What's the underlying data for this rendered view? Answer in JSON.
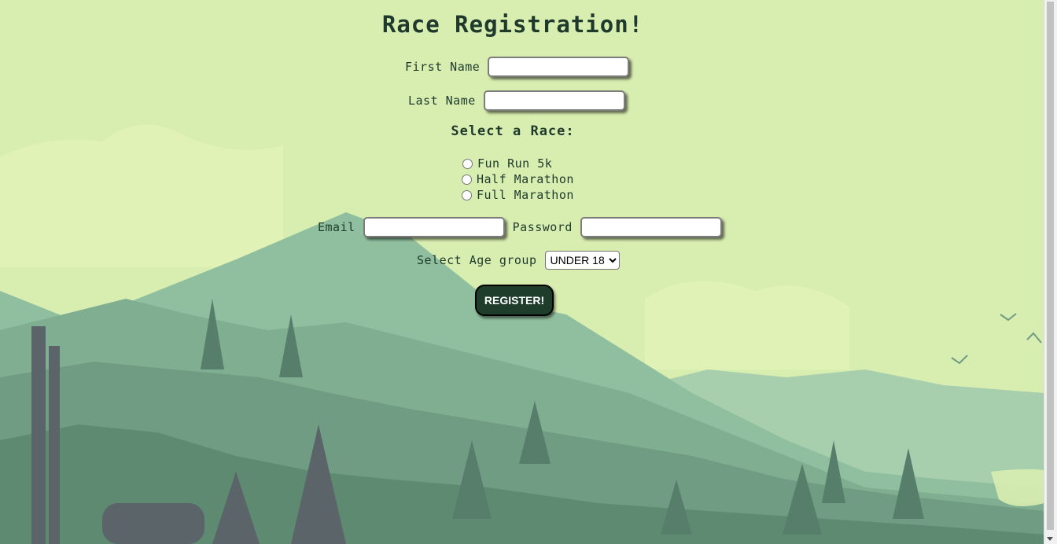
{
  "page": {
    "title": "Race Registration!",
    "first_name_label": "First Name",
    "first_name_value": "",
    "last_name_label": "Last Name",
    "last_name_value": "",
    "race_heading": "Select a Race:",
    "races": [
      "Fun Run 5k",
      "Half Marathon",
      "Full Marathon"
    ],
    "email_label": "Email",
    "email_value": "",
    "password_label": "Password",
    "password_value": "",
    "age_label": "Select Age group",
    "age_selected": "UNDER 18",
    "register_label": "REGISTER!"
  },
  "colors": {
    "sky": "#d8edb0",
    "text": "#1f3a2c",
    "button": "#1e3d2b"
  }
}
